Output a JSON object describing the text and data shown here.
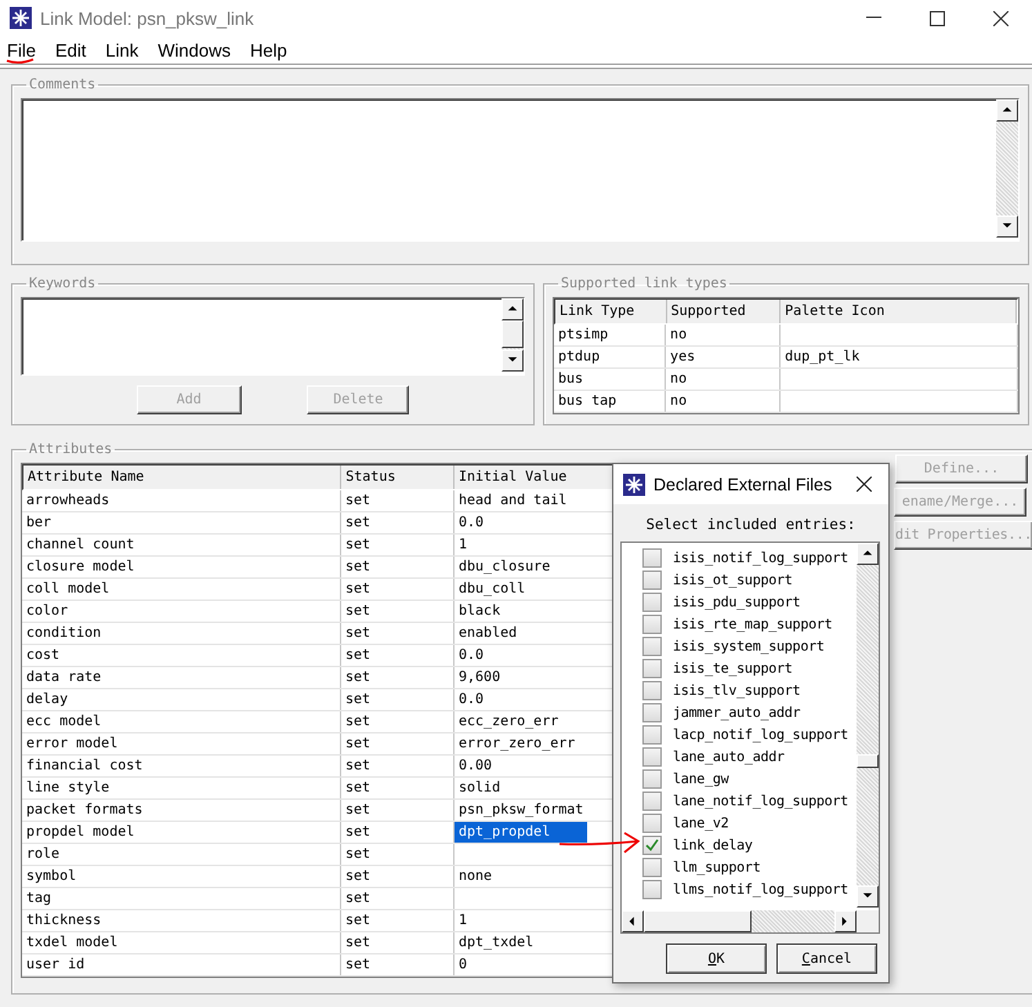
{
  "window": {
    "title": "Link Model: psn_pksw_link"
  },
  "menu": [
    {
      "label": "File"
    },
    {
      "label": "Edit"
    },
    {
      "label": "Link"
    },
    {
      "label": "Windows"
    },
    {
      "label": "Help"
    }
  ],
  "comments": {
    "label": "Comments"
  },
  "keywords": {
    "label": "Keywords",
    "buttons": [
      {
        "label": "Add",
        "disabled": true
      },
      {
        "label": "Delete",
        "disabled": true
      }
    ]
  },
  "supported_link_types": {
    "label": "Supported link types",
    "columns": [
      "Link Type",
      "Supported",
      "Palette Icon"
    ],
    "rows": [
      {
        "link_type": "ptsimp",
        "supported": "no"
      },
      {
        "link_type": "ptdup",
        "supported": "yes",
        "palette_icon": "dup_pt_lk"
      },
      {
        "link_type": "bus",
        "supported": "no"
      },
      {
        "link_type": "bus tap",
        "supported": "no"
      }
    ]
  },
  "attributes": {
    "label": "Attributes",
    "columns": [
      "Attribute Name",
      "Status",
      "Initial Value"
    ],
    "rows": [
      {
        "name": "arrowheads",
        "status": "set",
        "value": "head and tail",
        "selected": false
      },
      {
        "name": "ber",
        "status": "set",
        "value": "0.0",
        "selected": false
      },
      {
        "name": "channel count",
        "status": "set",
        "value": "1",
        "selected": false
      },
      {
        "name": "closure model",
        "status": "set",
        "value": "dbu_closure",
        "selected": false
      },
      {
        "name": "coll model",
        "status": "set",
        "value": "dbu_coll",
        "selected": false
      },
      {
        "name": "color",
        "status": "set",
        "value": "black",
        "selected": false
      },
      {
        "name": "condition",
        "status": "set",
        "value": "enabled",
        "selected": false
      },
      {
        "name": "cost",
        "status": "set",
        "value": "0.0",
        "selected": false
      },
      {
        "name": "data rate",
        "status": "set",
        "value": "9,600",
        "selected": false
      },
      {
        "name": "delay",
        "status": "set",
        "value": "0.0",
        "selected": false
      },
      {
        "name": "ecc model",
        "status": "set",
        "value": "ecc_zero_err",
        "selected": false
      },
      {
        "name": "error model",
        "status": "set",
        "value": "error_zero_err",
        "selected": false
      },
      {
        "name": "financial cost",
        "status": "set",
        "value": "0.00",
        "selected": false
      },
      {
        "name": "line style",
        "status": "set",
        "value": "solid",
        "selected": false
      },
      {
        "name": "packet formats",
        "status": "set",
        "value": "psn_pksw_format",
        "selected": false
      },
      {
        "name": "propdel model",
        "status": "set",
        "value": "dpt_propdel",
        "selected": true
      },
      {
        "name": "role",
        "status": "set",
        "selected": false
      },
      {
        "name": "symbol",
        "status": "set",
        "value": "none",
        "selected": false
      },
      {
        "name": "tag",
        "status": "set",
        "selected": false
      },
      {
        "name": "thickness",
        "status": "set",
        "value": "1",
        "selected": false
      },
      {
        "name": "txdel model",
        "status": "set",
        "value": "dpt_txdel",
        "selected": false
      },
      {
        "name": "user id",
        "status": "set",
        "value": "0",
        "selected": false
      }
    ],
    "buttons": [
      {
        "label": "Define...",
        "disabled": true
      },
      {
        "label": "ename/Merge...",
        "disabled": true
      },
      {
        "label": "dit Properties...",
        "disabled": true
      }
    ]
  },
  "dialog": {
    "title": "Declared External Files",
    "prompt": "Select included entries:",
    "entries": [
      {
        "label": "isis_notif_log_support",
        "checked": false
      },
      {
        "label": "isis_ot_support",
        "checked": false
      },
      {
        "label": "isis_pdu_support",
        "checked": false
      },
      {
        "label": "isis_rte_map_support",
        "checked": false
      },
      {
        "label": "isis_system_support",
        "checked": false
      },
      {
        "label": "isis_te_support",
        "checked": false
      },
      {
        "label": "isis_tlv_support",
        "checked": false
      },
      {
        "label": "jammer_auto_addr",
        "checked": false
      },
      {
        "label": "lacp_notif_log_support",
        "checked": false
      },
      {
        "label": "lane_auto_addr",
        "checked": false
      },
      {
        "label": "lane_gw",
        "checked": false
      },
      {
        "label": "lane_notif_log_support",
        "checked": false
      },
      {
        "label": "lane_v2",
        "checked": false
      },
      {
        "label": "link_delay",
        "checked": true
      },
      {
        "label": "llm_support",
        "checked": false
      },
      {
        "label": "llms_notif_log_support",
        "checked": false
      }
    ],
    "buttons": [
      {
        "label": "OK"
      },
      {
        "label": "Cancel"
      }
    ]
  }
}
